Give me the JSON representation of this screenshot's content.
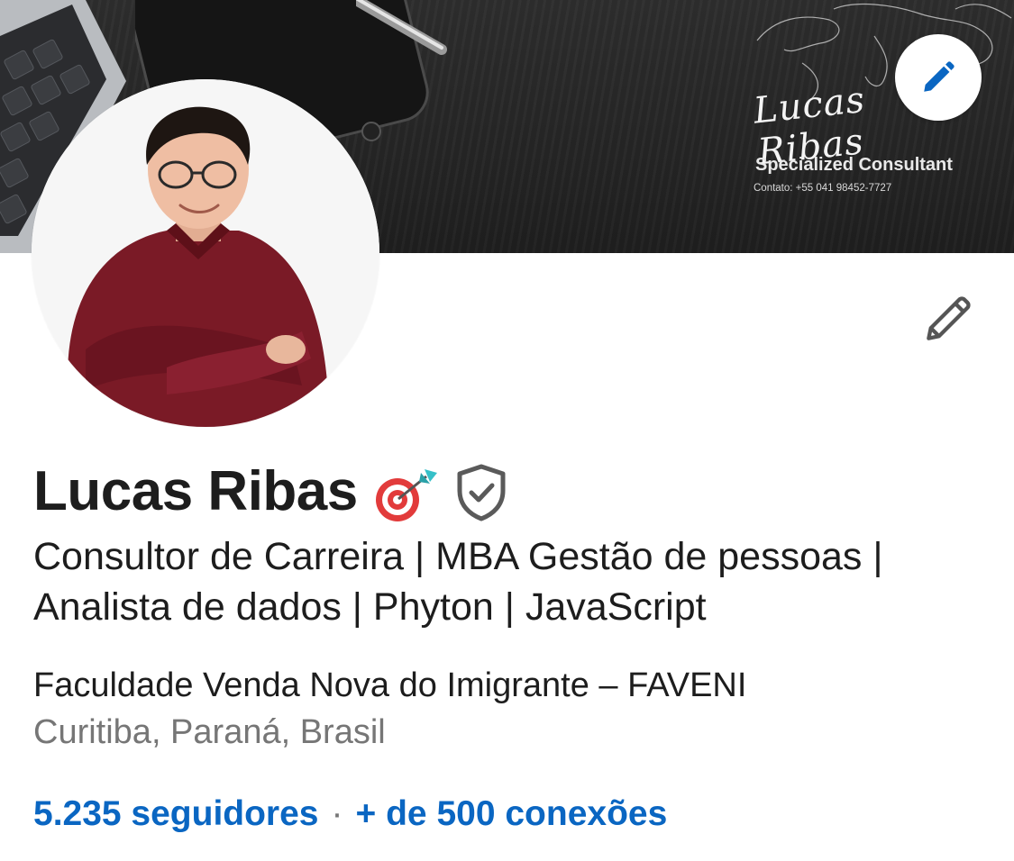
{
  "banner": {
    "signature": "Lucas Ribas",
    "tagline": "Specialized Consultant",
    "contact": "Contato: +55 041 98452-7727"
  },
  "profile": {
    "name": "Lucas Ribas",
    "headline": "Consultor de Carreira | MBA Gestão de pessoas | Analista de dados | Phyton | JavaScript",
    "school": "Faculdade Venda Nova do Imigrante – FAVENI",
    "location": "Curitiba, Paraná, Brasil",
    "followers": "5.235 seguidores",
    "separator": "·",
    "connections": "+ de 500 conexões"
  },
  "icons": {
    "banner_edit": "pencil-icon",
    "profile_edit": "pencil-outline-icon",
    "name_badge_emoji": "target-dart-icon",
    "verification": "shield-check-icon"
  },
  "colors": {
    "link": "#0a66c2",
    "text_primary": "#1d1d1d",
    "text_secondary": "#767676",
    "banner_bg": "#262626"
  }
}
